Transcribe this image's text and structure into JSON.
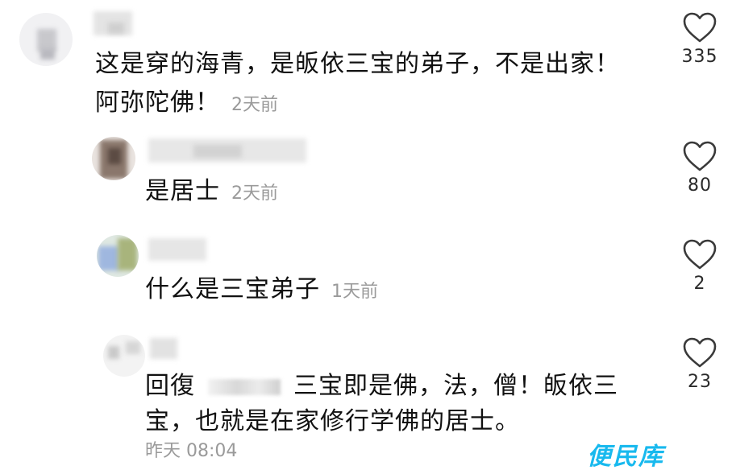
{
  "comments": [
    {
      "text_line1": "这是穿的海青，是皈依三宝的弟子，不是出家！",
      "text_line2": "阿弥陀佛！",
      "time": "2天前",
      "likes": "335"
    },
    {
      "text": "是居士",
      "time": "2天前",
      "likes": "80"
    },
    {
      "text": "什么是三宝弟子",
      "time": "1天前",
      "likes": "2"
    },
    {
      "reply_prefix": "回復",
      "text_line1": "三宝即是佛，法，僧！皈依三",
      "text_line2": "宝，也就是在家修行学佛的居士。",
      "time": "昨天 08:04",
      "likes": "23"
    }
  ],
  "watermark": "便民库",
  "colors": {
    "text": "#111111",
    "time": "#9a9a9a",
    "heart_stroke": "#3a3a3a",
    "watermark": "#18b9ee"
  },
  "icons": {
    "like": "heart-outline-icon"
  }
}
